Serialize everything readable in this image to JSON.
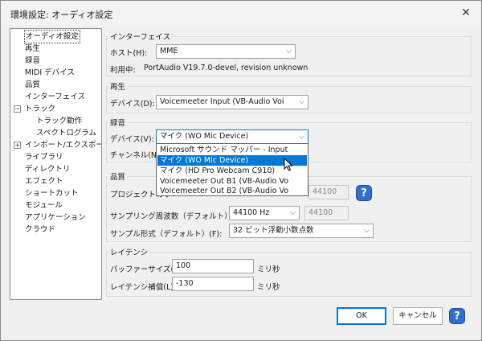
{
  "window": {
    "title": "環境設定: オーディオ設定",
    "close_glyph": "✕"
  },
  "tree": {
    "items": [
      {
        "label": "オーディオ設定"
      },
      {
        "label": "再生"
      },
      {
        "label": "録音"
      },
      {
        "label": "MIDI デバイス"
      },
      {
        "label": "品質"
      },
      {
        "label": "インターフェイス"
      },
      {
        "label": "トラック"
      },
      {
        "label": "トラック動作"
      },
      {
        "label": "スペクトログラム"
      },
      {
        "label": "インポート/エクスポート"
      },
      {
        "label": "ライブラリ"
      },
      {
        "label": "ディレクトリ"
      },
      {
        "label": "エフェクト"
      },
      {
        "label": "ショートカット"
      },
      {
        "label": "モジュール"
      },
      {
        "label": "アプリケーション"
      },
      {
        "label": "クラウド"
      }
    ],
    "collapse_glyph": "−",
    "expand_glyph": "+"
  },
  "interface": {
    "title": "インターフェイス",
    "host_label": "ホスト(H):",
    "host_value": "MME",
    "using_label": "利用中:",
    "using_value": "PortAudio V19.7.0-devel, revision unknown"
  },
  "playback": {
    "title": "再生",
    "device_label": "デバイス(D):",
    "device_value": "Voicemeeter Input (VB-Audio Voi"
  },
  "recording": {
    "title": "録音",
    "device_label": "デバイス(V):",
    "device_value": "マイク (WO Mic Device)",
    "channels_label": "チャンネル(N):",
    "options": [
      "Microsoft サウンド マッパー - Input",
      "マイク (WO Mic Device)",
      "マイク (HD Pro Webcam C910)",
      "Voicemeeter Out B1 (VB-Audio Vo",
      "Voicemeeter Out B2 (VB-Audio Vo"
    ],
    "highlighted_index": 1
  },
  "quality": {
    "title": "品質",
    "project_rate_label": "プロジェクトのサ",
    "project_rate_value": "44100",
    "help_glyph": "?",
    "default_rate_label": "サンプリング周波数（デフォルト）(E):",
    "default_rate_value": "44100 Hz",
    "default_rate_custom": "44100",
    "sample_format_label": "サンプル形式（デフォルト）(F):",
    "sample_format_value": "32 ビット浮動小数点数"
  },
  "latency": {
    "title": "レイテンシ",
    "buffer_label": "バッファーサイズ(B):",
    "buffer_value": "100",
    "buffer_unit": "ミリ秒",
    "compensation_label": "レイテンシ補償(L):",
    "compensation_value": "-130",
    "compensation_unit": "ミリ秒"
  },
  "buttons": {
    "ok": "OK",
    "cancel": "キャンセル",
    "help": "?"
  },
  "icons": {
    "dropdown_arrow": "⌵",
    "cursor": "arrow-pointer"
  },
  "colors": {
    "accent": "#0078d7",
    "help": "#2f6fd1"
  }
}
